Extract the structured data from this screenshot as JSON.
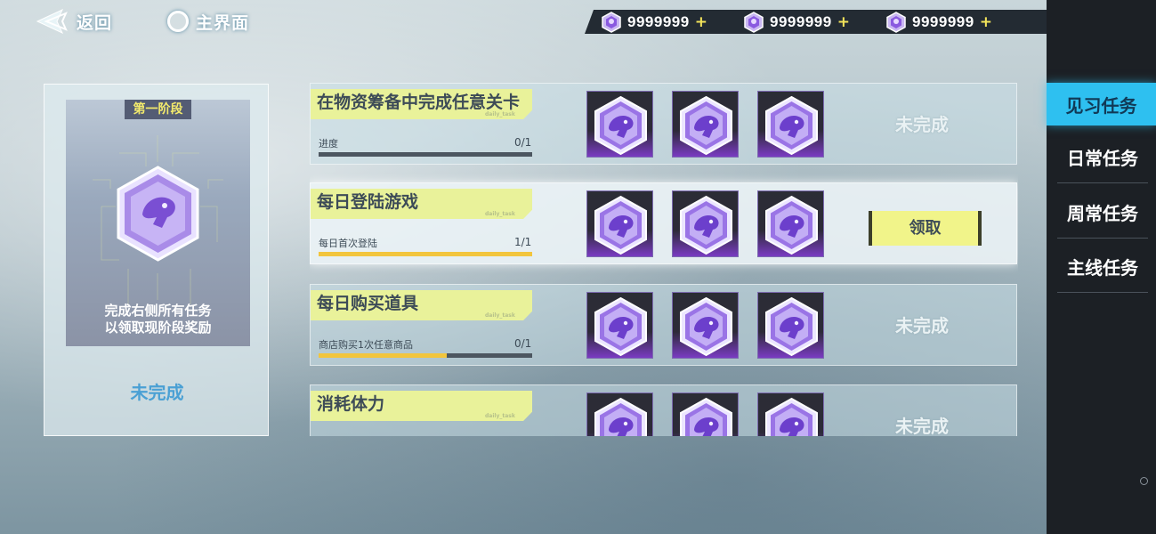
{
  "topbar": {
    "back_label": "返回",
    "home_label": "主界面"
  },
  "currencies": [
    {
      "icon": "gem-icon",
      "value": "9999999",
      "plus": "+"
    },
    {
      "icon": "gem-icon",
      "value": "9999999",
      "plus": "+"
    },
    {
      "icon": "gem-icon",
      "value": "9999999",
      "plus": "+"
    }
  ],
  "sidebar": {
    "tabs": [
      {
        "label": "见习任务",
        "active": true
      },
      {
        "label": "日常任务",
        "active": false
      },
      {
        "label": "周常任务",
        "active": false
      },
      {
        "label": "主线任务",
        "active": false
      }
    ]
  },
  "stage": {
    "tag": "第一阶段",
    "desc_line1": "完成右侧所有任务",
    "desc_line2": "以领取现阶段奖励",
    "status": "未完成"
  },
  "tasks": [
    {
      "title": "在物资筹备中完成任意关卡",
      "watermark": "daily_task",
      "desc": "进度",
      "progress_text": "0/1",
      "progress": 0,
      "state": "incomplete",
      "status_label": "未完成"
    },
    {
      "title": "每日登陆游戏",
      "watermark": "daily_task",
      "desc": "每日首次登陆",
      "progress_text": "1/1",
      "progress": 1,
      "state": "claimable",
      "status_label": "领取"
    },
    {
      "title": "每日购买道具",
      "watermark": "daily_task",
      "desc": "商店购买1次任意商品",
      "progress_text": "0/1",
      "progress": 0.6,
      "state": "incomplete",
      "status_label": "未完成"
    },
    {
      "title": "消耗体力",
      "watermark": "daily_task",
      "desc": "",
      "progress_text": "",
      "progress": 0,
      "state": "incomplete",
      "status_label": "未完成"
    }
  ],
  "colors": {
    "accent_tab": "#2ec0f0",
    "title_bg": "#e9f29a",
    "claim_bg": "#f1f48a",
    "progress_fill": "#f2c53d",
    "stage_status": "#4aa0d4"
  }
}
